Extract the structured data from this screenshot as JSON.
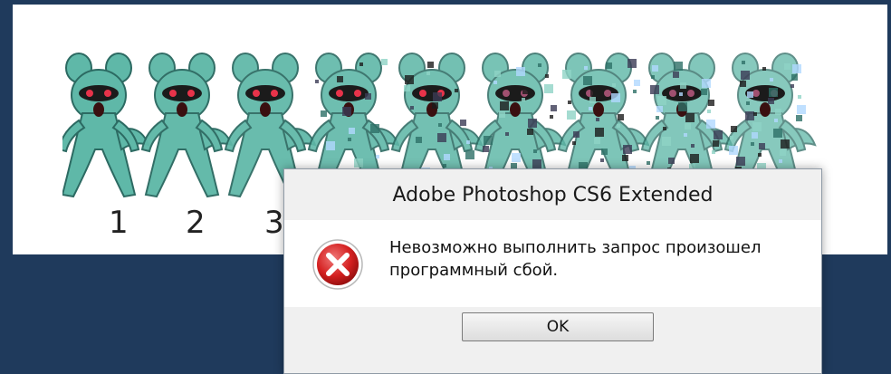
{
  "background": {
    "color": "#1f3a5c"
  },
  "image": {
    "numbers": [
      "1",
      "2",
      "3"
    ],
    "sprite_color": "#5fb8a8"
  },
  "dialog": {
    "title": "Adobe Photoshop CS6 Extended",
    "message_line1": "Невозможно выполнить запрос произошел",
    "message_line2": "программный сбой.",
    "icon": "error-icon",
    "ok_label": "OK"
  }
}
